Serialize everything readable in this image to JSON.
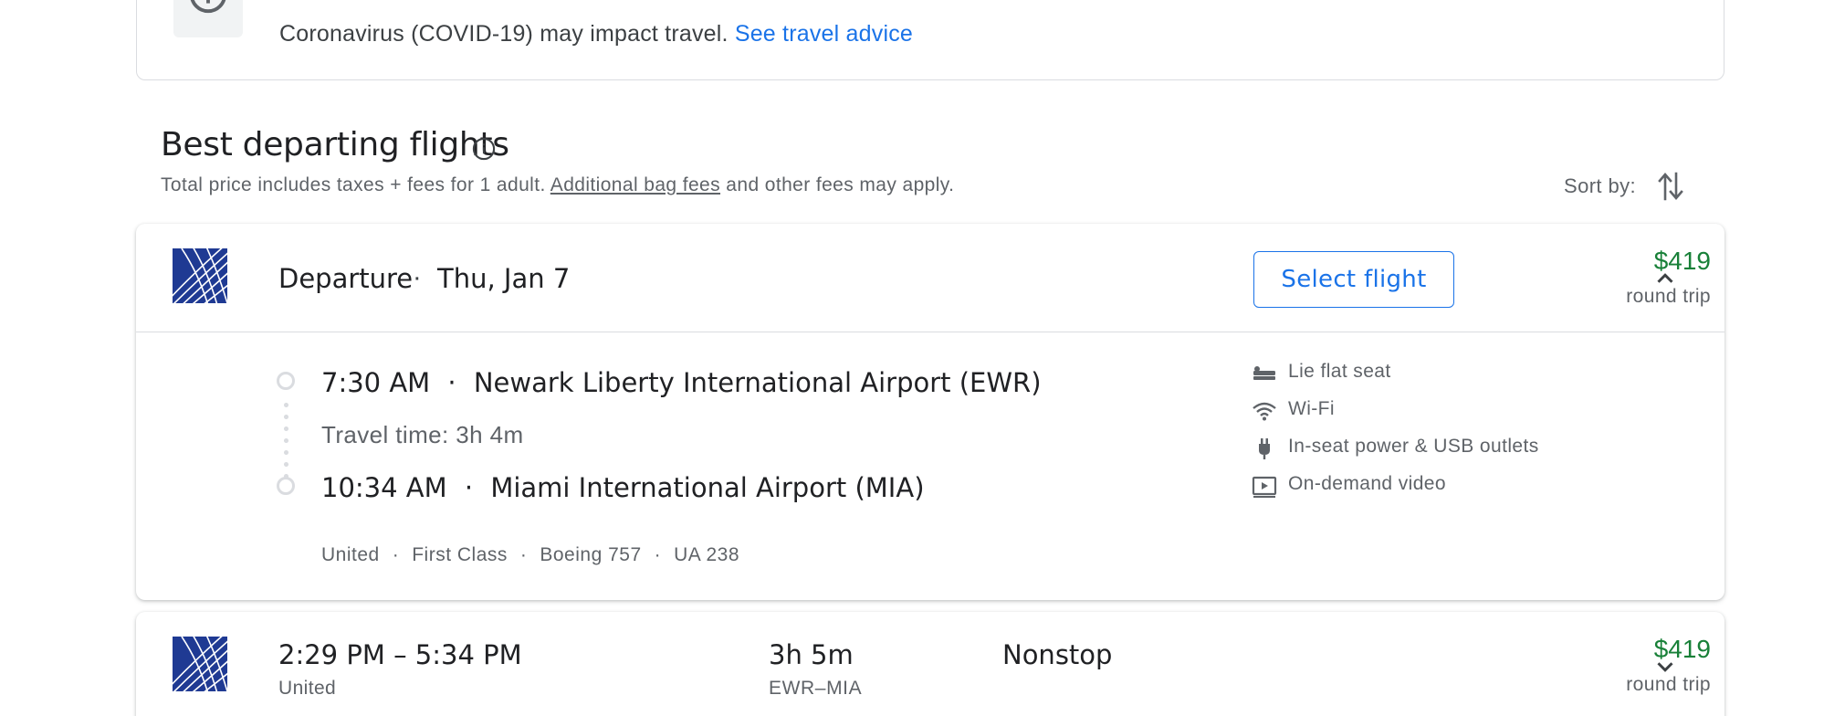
{
  "advisory": {
    "text": "Coronavirus (COVID-19) may impact travel.",
    "link": "See travel advice",
    "icon": "info-icon"
  },
  "section": {
    "title": "Best departing flights",
    "subtitle_pre": "Total price includes taxes + fees for 1 adult.",
    "subtitle_link": "Additional bag fees",
    "subtitle_post": "and other fees may apply.",
    "sort_label": "Sort by:"
  },
  "flight1": {
    "airline_logo": "united-globe-logo",
    "departure_label": "Departure",
    "dot": "·",
    "date": "Thu, Jan 7",
    "select_label": "Select flight",
    "price": "$419",
    "price_sub": "round trip",
    "dep_time": "7:30 AM",
    "dep_airport": "Newark Liberty International Airport (EWR)",
    "travel_time": "Travel time: 3h 4m",
    "arr_time": "10:34 AM",
    "arr_airport": "Miami International Airport (MIA)",
    "meta": [
      "United",
      "First Class",
      "Boeing 757",
      "UA 238"
    ],
    "amenities": [
      {
        "icon": "lie-flat-seat-icon",
        "label": "Lie flat seat"
      },
      {
        "icon": "wifi-icon",
        "label": "Wi-Fi"
      },
      {
        "icon": "power-plug-icon",
        "label": "In-seat power & USB outlets"
      },
      {
        "icon": "video-icon",
        "label": "On-demand video"
      }
    ]
  },
  "flight2": {
    "airline_logo": "united-globe-logo",
    "times": "2:29 PM – 5:34 PM",
    "airline": "United",
    "duration": "3h 5m",
    "route": "EWR–MIA",
    "stops": "Nonstop",
    "price": "$419",
    "price_sub": "round trip"
  },
  "colors": {
    "accent": "#1a73e8",
    "price": "#188038",
    "united_blue": "#1f3a93"
  }
}
